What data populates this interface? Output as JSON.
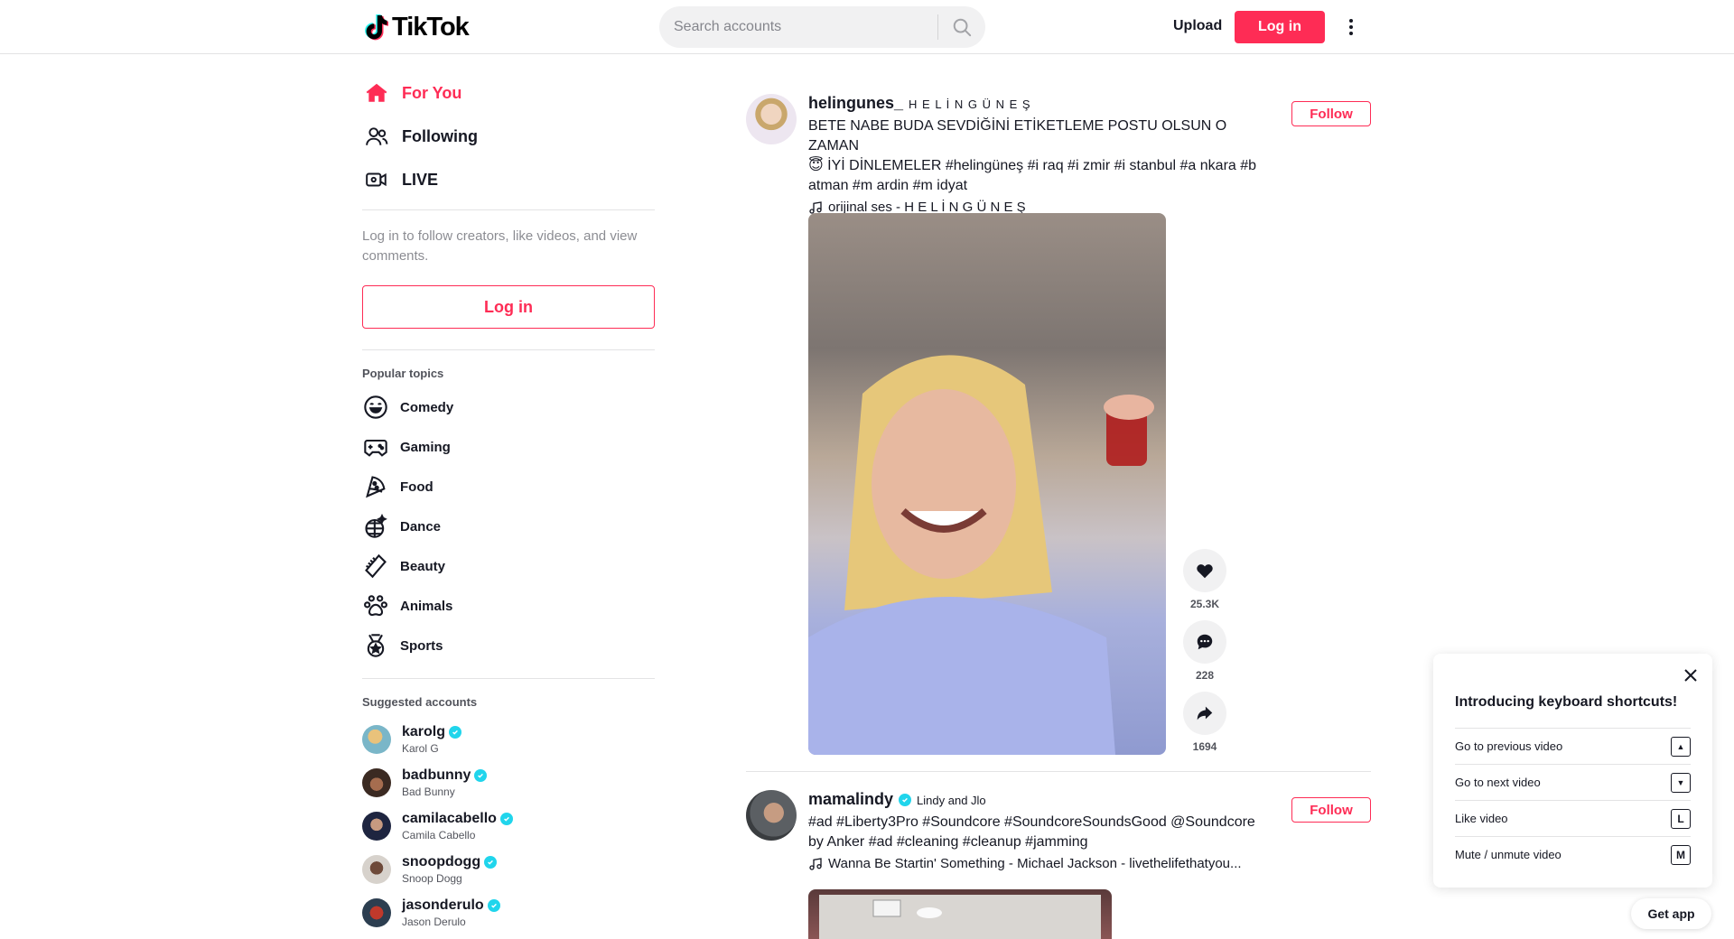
{
  "colors": {
    "brand": "#fe2c55",
    "verified": "#20d5ec",
    "text": "#161823"
  },
  "header": {
    "logo_text": "TikTok",
    "search_placeholder": "Search accounts",
    "upload_label": "Upload",
    "login_label": "Log in"
  },
  "sidebar": {
    "nav": [
      {
        "label": "For You",
        "icon": "home-icon"
      },
      {
        "label": "Following",
        "icon": "people-icon"
      },
      {
        "label": "LIVE",
        "icon": "live-icon"
      }
    ],
    "login_hint": "Log in to follow creators, like videos, and view comments.",
    "login_button": "Log in",
    "popular_title": "Popular topics",
    "topics": [
      {
        "label": "Comedy",
        "icon": "smile-icon"
      },
      {
        "label": "Gaming",
        "icon": "gamepad-icon"
      },
      {
        "label": "Food",
        "icon": "pizza-icon"
      },
      {
        "label": "Dance",
        "icon": "disco-ball-icon"
      },
      {
        "label": "Beauty",
        "icon": "comb-icon"
      },
      {
        "label": "Animals",
        "icon": "paw-icon"
      },
      {
        "label": "Sports",
        "icon": "medal-icon"
      }
    ],
    "suggested_title": "Suggested accounts",
    "accounts": [
      {
        "handle": "karolg",
        "name": "Karol G"
      },
      {
        "handle": "badbunny",
        "name": "Bad Bunny"
      },
      {
        "handle": "camilacabello",
        "name": "Camila Cabello"
      },
      {
        "handle": "snoopdogg",
        "name": "Snoop Dogg"
      },
      {
        "handle": "jasonderulo",
        "name": "Jason Derulo"
      }
    ]
  },
  "posts": [
    {
      "handle": "helingunes_",
      "display": "H E L İ N G Ü N E Ş",
      "caption_1": "BETE NABE BUDA SEVDİĞİNİ ETİKETLEME POSTU OLSUN O ZAMAN",
      "caption_2": "😇 İYİ DİNLEMELER #helingüneş #i raq #i zmir #i stanbul #a nkara #b",
      "caption_3": "atman #m ardin #m idyat",
      "music": "orijinal ses -  H E L İ N G Ü N E Ş",
      "follow_label": "Follow",
      "likes": "25.3K",
      "comments": "228",
      "shares": "1694"
    },
    {
      "handle": "mamalindy",
      "display": "Lindy and Jlo",
      "caption_1": "#ad #Liberty3Pro #Soundcore #SoundcoreSoundsGood @Soundcore",
      "caption_2": "by Anker #ad #cleaning #cleanup #jamming",
      "music": "Wanna Be Startin' Something - Michael Jackson - livethelifethatyou...",
      "follow_label": "Follow"
    }
  ],
  "keyboard_popup": {
    "title": "Introducing keyboard shortcuts!",
    "rows": [
      {
        "label": "Go to previous video",
        "key": "▲"
      },
      {
        "label": "Go to next video",
        "key": "▼"
      },
      {
        "label": "Like video",
        "key": "L"
      },
      {
        "label": "Mute / unmute video",
        "key": "M"
      }
    ]
  },
  "get_app_label": "Get app"
}
